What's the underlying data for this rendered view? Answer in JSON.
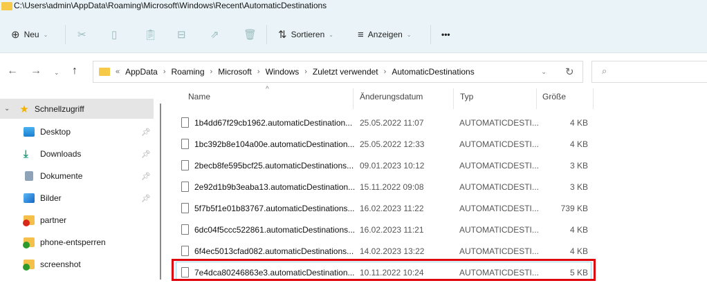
{
  "window": {
    "title": "C:\\Users\\admin\\AppData\\Roaming\\Microsoft\\Windows\\Recent\\AutomaticDestinations"
  },
  "toolbar": {
    "new_label": "Neu",
    "sort_label": "Sortieren",
    "view_label": "Anzeigen",
    "more_label": "•••",
    "icons": [
      "cut-icon",
      "copy-icon",
      "paste-icon",
      "rename-icon",
      "share-icon",
      "delete-icon"
    ]
  },
  "address": {
    "overflow": "«",
    "crumbs": [
      "AppData",
      "Roaming",
      "Microsoft",
      "Windows",
      "Zuletzt verwendet",
      "AutomaticDestinations"
    ]
  },
  "search": {
    "placeholder": ""
  },
  "sidebar": {
    "quick_access": "Schnellzugriff",
    "items": [
      {
        "label": "Desktop",
        "pinned": true,
        "icon": "desktop-icon"
      },
      {
        "label": "Downloads",
        "pinned": true,
        "icon": "download-icon"
      },
      {
        "label": "Dokumente",
        "pinned": true,
        "icon": "documents-icon"
      },
      {
        "label": "Bilder",
        "pinned": true,
        "icon": "pictures-icon"
      },
      {
        "label": "partner",
        "pinned": false,
        "icon": "folder-error-icon"
      },
      {
        "label": "phone-entsperren",
        "pinned": false,
        "icon": "folder-synced-icon"
      },
      {
        "label": "screenshot",
        "pinned": false,
        "icon": "folder-synced-icon"
      }
    ]
  },
  "columns": {
    "name": "Name",
    "date": "Änderungsdatum",
    "type": "Typ",
    "size": "Größe"
  },
  "files": [
    {
      "name": "1b4dd67f29cb1962.automaticDestination...",
      "date": "25.05.2022 11:07",
      "type": "AUTOMATICDESTI...",
      "size": "4 KB"
    },
    {
      "name": "1bc392b8e104a00e.automaticDestination...",
      "date": "25.05.2022 12:33",
      "type": "AUTOMATICDESTI...",
      "size": "4 KB"
    },
    {
      "name": "2becb8fe595bcf25.automaticDestinations...",
      "date": "09.01.2023 10:12",
      "type": "AUTOMATICDESTI...",
      "size": "3 KB"
    },
    {
      "name": "2e92d1b9b3eaba13.automaticDestination...",
      "date": "15.11.2022 09:08",
      "type": "AUTOMATICDESTI...",
      "size": "3 KB"
    },
    {
      "name": "5f7b5f1e01b83767.automaticDestinations...",
      "date": "16.02.2023 11:22",
      "type": "AUTOMATICDESTI...",
      "size": "739 KB"
    },
    {
      "name": "6dc04f5ccc522861.automaticDestinations...",
      "date": "16.02.2023 11:21",
      "type": "AUTOMATICDESTI...",
      "size": "4 KB"
    },
    {
      "name": "6f4ec5013cfad082.automaticDestinations...",
      "date": "14.02.2023 13:22",
      "type": "AUTOMATICDESTI...",
      "size": "4 KB"
    },
    {
      "name": "7e4dca80246863e3.automaticDestination...",
      "date": "10.11.2022 10:24",
      "type": "AUTOMATICDESTI...",
      "size": "5 KB"
    }
  ],
  "highlight_color": "#e0000c"
}
